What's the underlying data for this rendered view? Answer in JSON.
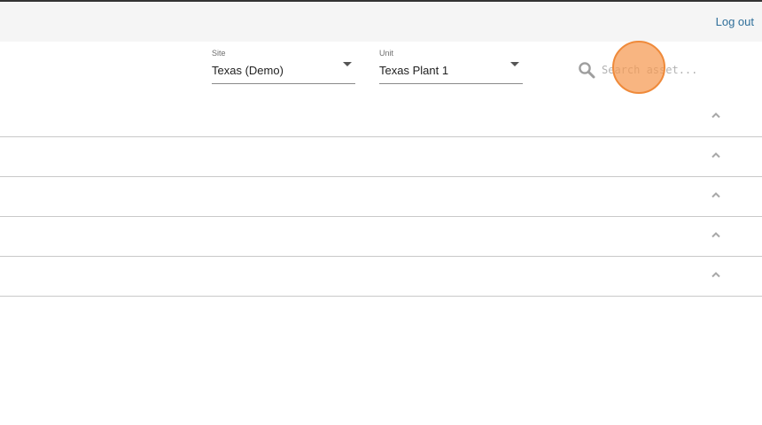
{
  "header": {
    "logout_label": "Log out"
  },
  "filters": {
    "site": {
      "label": "Site",
      "value": "Texas (Demo)"
    },
    "unit": {
      "label": "Unit",
      "value": "Texas Plant 1"
    }
  },
  "search": {
    "placeholder": "Search asset..."
  },
  "rows": [
    {
      "expanded": true
    },
    {
      "expanded": true
    },
    {
      "expanded": true
    },
    {
      "expanded": true
    },
    {
      "expanded": true
    }
  ],
  "icons": {
    "search": "search-icon",
    "row_toggle": "chevron-up-icon"
  },
  "colors": {
    "link": "#2f6f9a",
    "click_marker": "#f5a265",
    "divider": "#c9c9c9"
  }
}
